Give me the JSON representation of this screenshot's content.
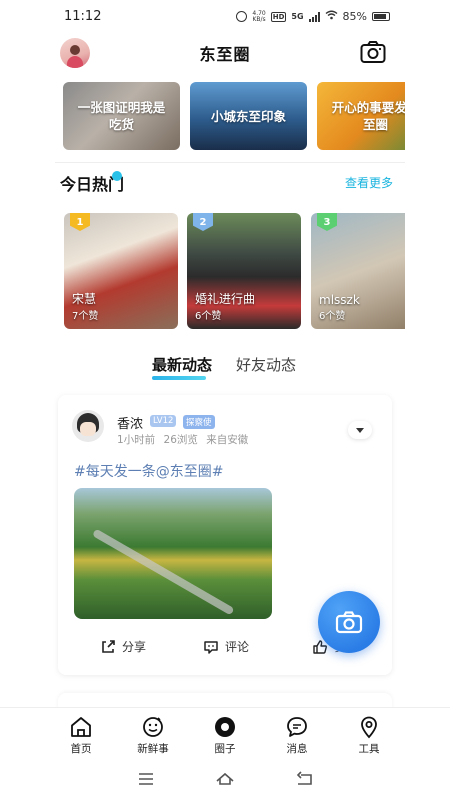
{
  "status_bar": {
    "time": "11:12",
    "net_speed": "4.70\nKB/s",
    "hd": "HD",
    "network": "5G",
    "battery": "85%"
  },
  "header": {
    "title": "东至圈"
  },
  "banners": [
    {
      "label": "一张图证明我是吃货"
    },
    {
      "label": "小城东至印象"
    },
    {
      "label": "开心的事要发东至圈"
    }
  ],
  "hot": {
    "title": "今日热门",
    "see_more": "查看更多",
    "items": [
      {
        "rank": "1",
        "name": "宋慧",
        "likes": "7个赞"
      },
      {
        "rank": "2",
        "name": "婚礼进行曲",
        "likes": "6个赞"
      },
      {
        "rank": "3",
        "name": "mlsszk",
        "likes": "6个赞"
      }
    ]
  },
  "feed_tabs": {
    "active": "最新动态",
    "inactive": "好友动态"
  },
  "post": {
    "author": "香浓",
    "level": "LV12",
    "role": "探察使",
    "time_ago": "1小时前",
    "views": "26浏览",
    "source": "来自安徽",
    "hashtag": "#每天发一条@东至圈#",
    "actions": {
      "share": "分享",
      "comment": "评论",
      "like": "赞"
    }
  },
  "bottom_nav": [
    {
      "label": "首页",
      "icon": "home-icon"
    },
    {
      "label": "新鲜事",
      "icon": "smiley-icon"
    },
    {
      "label": "圈子",
      "icon": "circle-icon"
    },
    {
      "label": "消息",
      "icon": "message-icon"
    },
    {
      "label": "工具",
      "icon": "location-icon"
    }
  ],
  "colors": {
    "accent": "#19b4df",
    "fab": "#1d6fe0",
    "hashtag": "#5d7fb3"
  }
}
